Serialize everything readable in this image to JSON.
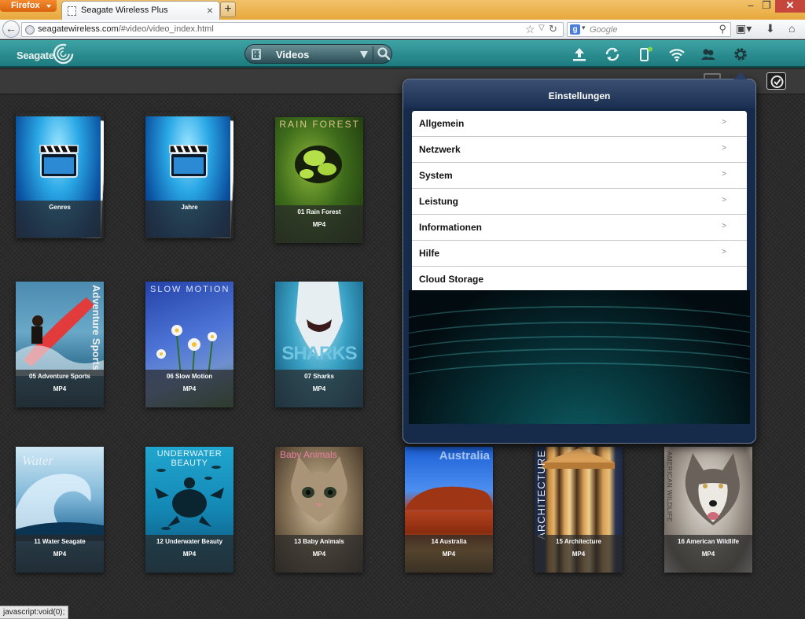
{
  "browser": {
    "app_button": "Firefox",
    "tab_title": "Seagate Wireless Plus",
    "url_host": "seagatewireless.com",
    "url_path": "/#video/video_index.html",
    "search_engine_icon": "google-g",
    "search_placeholder": "Google",
    "status_text": "javascript:void(0);"
  },
  "app": {
    "logo": "Seagate",
    "section": "Videos"
  },
  "settings": {
    "title": "Einstellungen",
    "items": [
      {
        "label": "Allgemein",
        "chevron": true
      },
      {
        "label": "Netzwerk",
        "chevron": true
      },
      {
        "label": "System",
        "chevron": true
      },
      {
        "label": "Leistung",
        "chevron": true
      },
      {
        "label": "Informationen",
        "chevron": true
      },
      {
        "label": "Hilfe",
        "chevron": true
      },
      {
        "label": "Cloud Storage",
        "chevron": false
      }
    ]
  },
  "tiles": [
    {
      "title": "Genres",
      "format": "",
      "art": "folder-water"
    },
    {
      "title": "Jahre",
      "format": "",
      "art": "folder-water"
    },
    {
      "title": "01 Rain Forest",
      "format": "MP4",
      "art": "forest",
      "banner": "RAIN FOREST"
    },
    {
      "title": "05 Adventure Sports",
      "format": "MP4",
      "art": "surf",
      "banner": "Adventure Sports"
    },
    {
      "title": "06 Slow Motion",
      "format": "MP4",
      "art": "slow",
      "banner": "SLOW MOTION"
    },
    {
      "title": "07 Sharks",
      "format": "MP4",
      "art": "shark",
      "banner": "SHARKS"
    },
    {
      "title": "11 Water Seagate",
      "format": "MP4",
      "art": "wave",
      "banner": "Water"
    },
    {
      "title": "12 Underwater Beauty",
      "format": "MP4",
      "art": "underwater",
      "banner": "UNDERWATER BEAUTY"
    },
    {
      "title": "13 Baby Animals",
      "format": "MP4",
      "art": "kitten",
      "banner": "Baby Animals"
    },
    {
      "title": "14 Australia",
      "format": "MP4",
      "art": "australia",
      "banner": "Australia"
    },
    {
      "title": "15 Architecture",
      "format": "MP4",
      "art": "arch",
      "banner": "ARCHITECTURE"
    },
    {
      "title": "16 American Wildlife",
      "format": "MP4",
      "art": "wolf",
      "banner": "AMERICAN WILDLIFE"
    }
  ],
  "colors": {
    "header_teal": "#2a8f91",
    "panel_navy": "#162a4a",
    "firefox_orange": "#e86d1a"
  }
}
